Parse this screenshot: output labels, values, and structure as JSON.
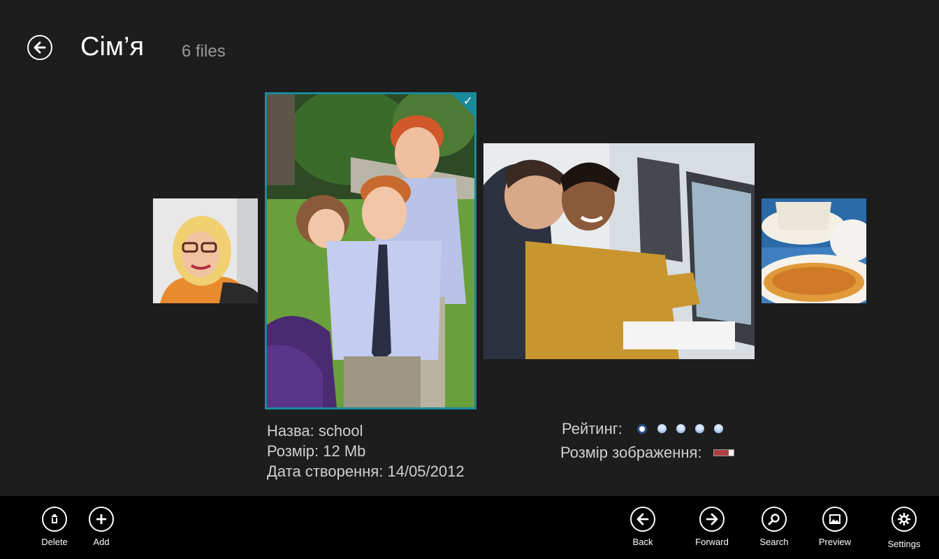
{
  "header": {
    "title": "Сім’я",
    "file_count": "6 files"
  },
  "gallery": {
    "selected_index": 1,
    "photos": [
      {
        "subject": "woman with glasses portrait"
      },
      {
        "subject": "children in school uniforms"
      },
      {
        "subject": "two people at computer monitors"
      },
      {
        "subject": "teacup and pie"
      }
    ]
  },
  "info": {
    "name": "Назва: school",
    "size": "Розмір: 12 Mb",
    "date": "Дата створення: 14/05/2012",
    "rating_label": "Рейтинг:",
    "rating_value": 1,
    "rating_max": 5,
    "image_size_label": "Розмір зображення:",
    "image_size_fraction": 0.75
  },
  "appbar": {
    "left": [
      {
        "id": "delete",
        "label": "Delete",
        "icon": "trash-icon"
      },
      {
        "id": "add",
        "label": "Add",
        "icon": "plus-icon"
      }
    ],
    "right": [
      {
        "id": "back",
        "label": "Back",
        "icon": "arrow-left-icon"
      },
      {
        "id": "forward",
        "label": "Forward",
        "icon": "arrow-right-icon"
      },
      {
        "id": "search",
        "label": "Search",
        "icon": "search-icon"
      },
      {
        "id": "preview",
        "label": "Preview",
        "icon": "picture-icon"
      },
      {
        "id": "settings",
        "label": "Settings",
        "icon": "gear-icon"
      }
    ]
  },
  "colors": {
    "background": "#1d1d1d",
    "accent": "#1b8a9a",
    "appbar": "#000000"
  }
}
